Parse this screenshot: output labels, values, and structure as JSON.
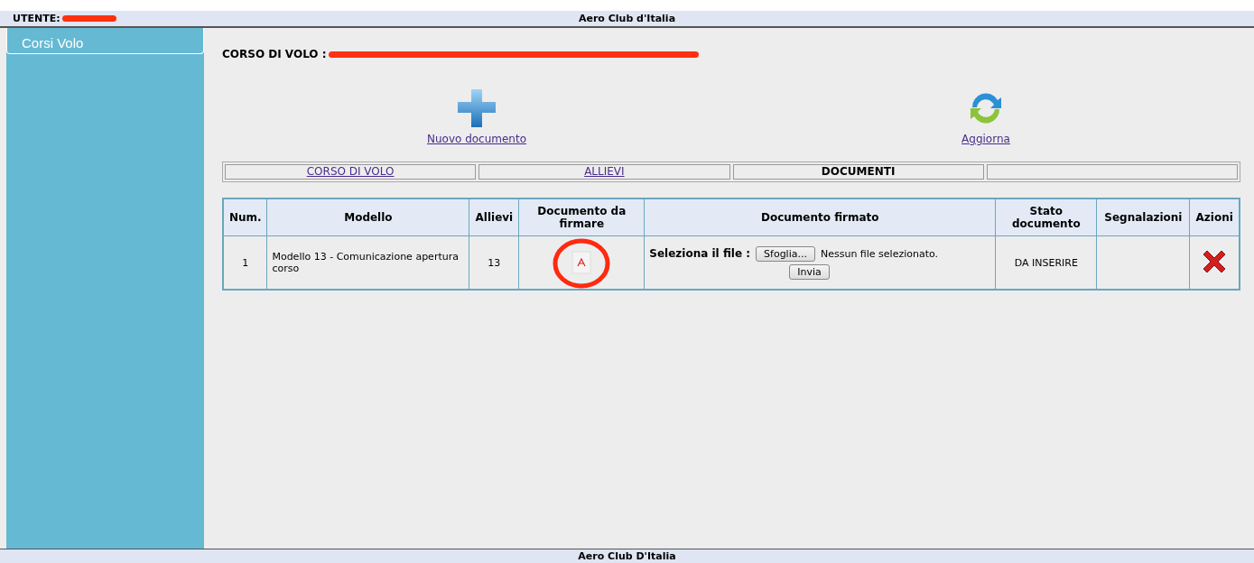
{
  "header": {
    "user_label": "UTENTE:",
    "title": "Aero Club d'Italia"
  },
  "sidebar": {
    "items": [
      {
        "label": "Corsi Volo",
        "selected": true
      }
    ]
  },
  "course": {
    "label": "CORSO DI VOLO :"
  },
  "actions": [
    {
      "kind": "add",
      "label": "Nuovo documento"
    },
    {
      "kind": "refresh",
      "label": "Aggiorna"
    }
  ],
  "tabs": [
    {
      "label": "CORSO DI VOLO",
      "selected": false
    },
    {
      "label": "ALLIEVI",
      "selected": false
    },
    {
      "label": "DOCUMENTI",
      "selected": true
    }
  ],
  "table": {
    "columns": [
      "Num.",
      "Modello",
      "Allievi",
      "Documento da firmare",
      "Documento firmato",
      "Stato documento",
      "Segnalazioni",
      "Azioni"
    ],
    "rows": [
      {
        "num": "1",
        "modello": "Modello 13 - Comunicazione apertura corso",
        "allievi": "13",
        "file_label": "Seleziona il file :",
        "browse_button": "Sfoglia...",
        "file_status": "Nessun file selezionato.",
        "send_button": "Invia",
        "stato": "DA INSERIRE"
      }
    ]
  },
  "footer": {
    "title": "Aero Club D'Italia"
  }
}
